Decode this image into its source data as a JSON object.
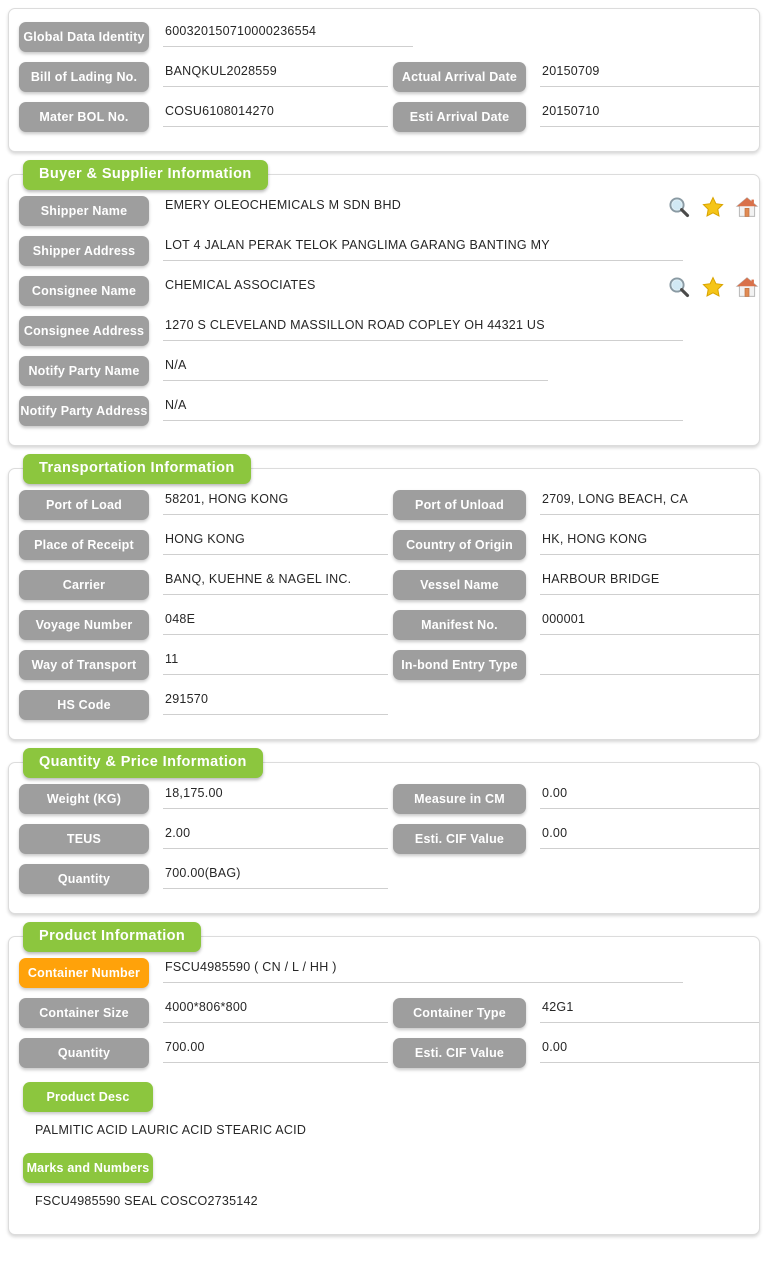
{
  "colors": {
    "section_green": "#8CC63E",
    "label_gray": "#9E9E9E",
    "container_orange": "#FFA20A",
    "value_text": "#262626",
    "underline": "#cfcfcf"
  },
  "identity": {
    "fields": [
      {
        "label": "Global Data Identity",
        "value": "600320150710000236554"
      },
      {
        "label": "Bill of Lading No.",
        "value": "BANQKUL2028559"
      },
      {
        "label": "Actual Arrival Date",
        "value": "20150709"
      },
      {
        "label": "Mater BOL No.",
        "value": "COSU6108014270"
      },
      {
        "label": "Esti Arrival Date",
        "value": "20150710"
      }
    ]
  },
  "buyer_supplier": {
    "title": "Buyer & Supplier Information",
    "fields": [
      {
        "label": "Shipper Name",
        "value": "EMERY OLEOCHEMICALS M SDN BHD"
      },
      {
        "label": "Shipper Address",
        "value": "LOT 4 JALAN PERAK TELOK PANGLIMA GARANG BANTING MY"
      },
      {
        "label": "Consignee Name",
        "value": "CHEMICAL ASSOCIATES"
      },
      {
        "label": "Consignee Address",
        "value": "1270 S CLEVELAND MASSILLON ROAD COPLEY OH 44321 US"
      },
      {
        "label": "Notify Party Name",
        "value": "N/A"
      },
      {
        "label": "Notify Party Address",
        "value": "N/A"
      }
    ],
    "icons": [
      {
        "name": "search-icon",
        "title": "search"
      },
      {
        "name": "star-icon",
        "title": "favorite"
      },
      {
        "name": "home-icon",
        "title": "home"
      }
    ]
  },
  "transportation": {
    "title": "Transportation Information",
    "fields": [
      {
        "label": "Port of Load",
        "value": "58201, HONG KONG"
      },
      {
        "label": "Port of Unload",
        "value": "2709, LONG BEACH, CA"
      },
      {
        "label": "Place of Receipt",
        "value": "HONG KONG"
      },
      {
        "label": "Country of Origin",
        "value": "HK, HONG KONG"
      },
      {
        "label": "Carrier",
        "value": "BANQ, KUEHNE & NAGEL INC."
      },
      {
        "label": "Vessel Name",
        "value": "HARBOUR BRIDGE"
      },
      {
        "label": "Voyage Number",
        "value": "048E"
      },
      {
        "label": "Manifest No.",
        "value": "000001"
      },
      {
        "label": "Way of Transport",
        "value": "11"
      },
      {
        "label": "In-bond Entry Type",
        "value": ""
      },
      {
        "label": "HS Code",
        "value": "291570"
      }
    ]
  },
  "quantity_price": {
    "title": "Quantity & Price Information",
    "fields": [
      {
        "label": "Weight (KG)",
        "value": "18,175.00"
      },
      {
        "label": "Measure in CM",
        "value": "0.00"
      },
      {
        "label": "TEUS",
        "value": "2.00"
      },
      {
        "label": "Esti. CIF Value",
        "value": "0.00"
      },
      {
        "label": "Quantity",
        "value": "700.00(BAG)"
      }
    ]
  },
  "product": {
    "title": "Product Information",
    "fields": [
      {
        "label": "Container Number",
        "value": "FSCU4985590 ( CN / L / HH )"
      },
      {
        "label": "Container Size",
        "value": "4000*806*800"
      },
      {
        "label": "Container Type",
        "value": "42G1"
      },
      {
        "label": "Quantity",
        "value": "700.00"
      },
      {
        "label": "Esti. CIF Value",
        "value": "0.00"
      }
    ],
    "product_desc_label": "Product Desc",
    "product_desc_value": "PALMITIC ACID LAURIC ACID STEARIC ACID",
    "marks_label": "Marks and Numbers",
    "marks_value": "FSCU4985590 SEAL COSCO2735142"
  }
}
